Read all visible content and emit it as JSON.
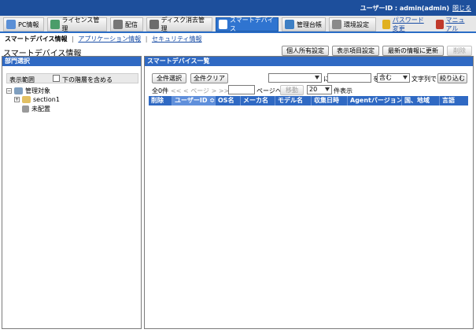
{
  "topbar": {
    "user_label": "ユーザーID : admin(admin)",
    "close": "閉じる"
  },
  "nav": {
    "items": [
      {
        "label": "PC情報",
        "icon": "pc-icon"
      },
      {
        "label": "ライセンス管理",
        "icon": "license-icon"
      },
      {
        "label": "配信",
        "icon": "delivery-icon"
      },
      {
        "label": "ディスク消去管理",
        "icon": "disk-erase-icon"
      },
      {
        "label": "スマートデバイス",
        "icon": "smart-device-icon"
      },
      {
        "label": "管理台帳",
        "icon": "ledger-icon"
      },
      {
        "label": "環境設定",
        "icon": "settings-icon"
      },
      {
        "label": "パスワード変更",
        "icon": "key-icon"
      },
      {
        "label": "マニュアル",
        "icon": "manual-icon"
      }
    ]
  },
  "subnav": {
    "current": "スマートデバイス情報",
    "app_info": "アプリケーション情報",
    "security_info": "セキュリティ情報"
  },
  "page": {
    "title": "スマートデバイス情報",
    "buttons": {
      "owner_settings": "個人所有設定",
      "display_settings": "表示項目設定",
      "refresh": "最新の情報に更新",
      "delete": "削除"
    }
  },
  "left_panel": {
    "title": "部門選択",
    "scope_label": "表示範囲",
    "include_lower": "下の階層を含める",
    "tree": {
      "root": "管理対象",
      "section": "section1",
      "unassigned": "未配置"
    }
  },
  "right_panel": {
    "title": "スマートデバイス一覧",
    "select_all": "全件選択",
    "clear_all": "全件クリア",
    "ni": "に",
    "wo": "を",
    "match_mode": "含む",
    "string_suffix": "文字列で",
    "filter": "絞り込む",
    "count": "全0件",
    "pager": "<< < ページ > >>",
    "page_suffix": "ページへ",
    "move": "移動",
    "per_page": "20",
    "per_page_suffix": "件表示",
    "columns": [
      "削除",
      "ユーザーID ≎",
      "OS名",
      "メーカ名",
      "モデル名",
      "収集日時",
      "Agentバージョン",
      "国、地域",
      "言語"
    ]
  },
  "colors": {
    "topbar": "#1d4f9c",
    "active_tab": "#2f74d0",
    "panel_head": "#2f69c3"
  }
}
